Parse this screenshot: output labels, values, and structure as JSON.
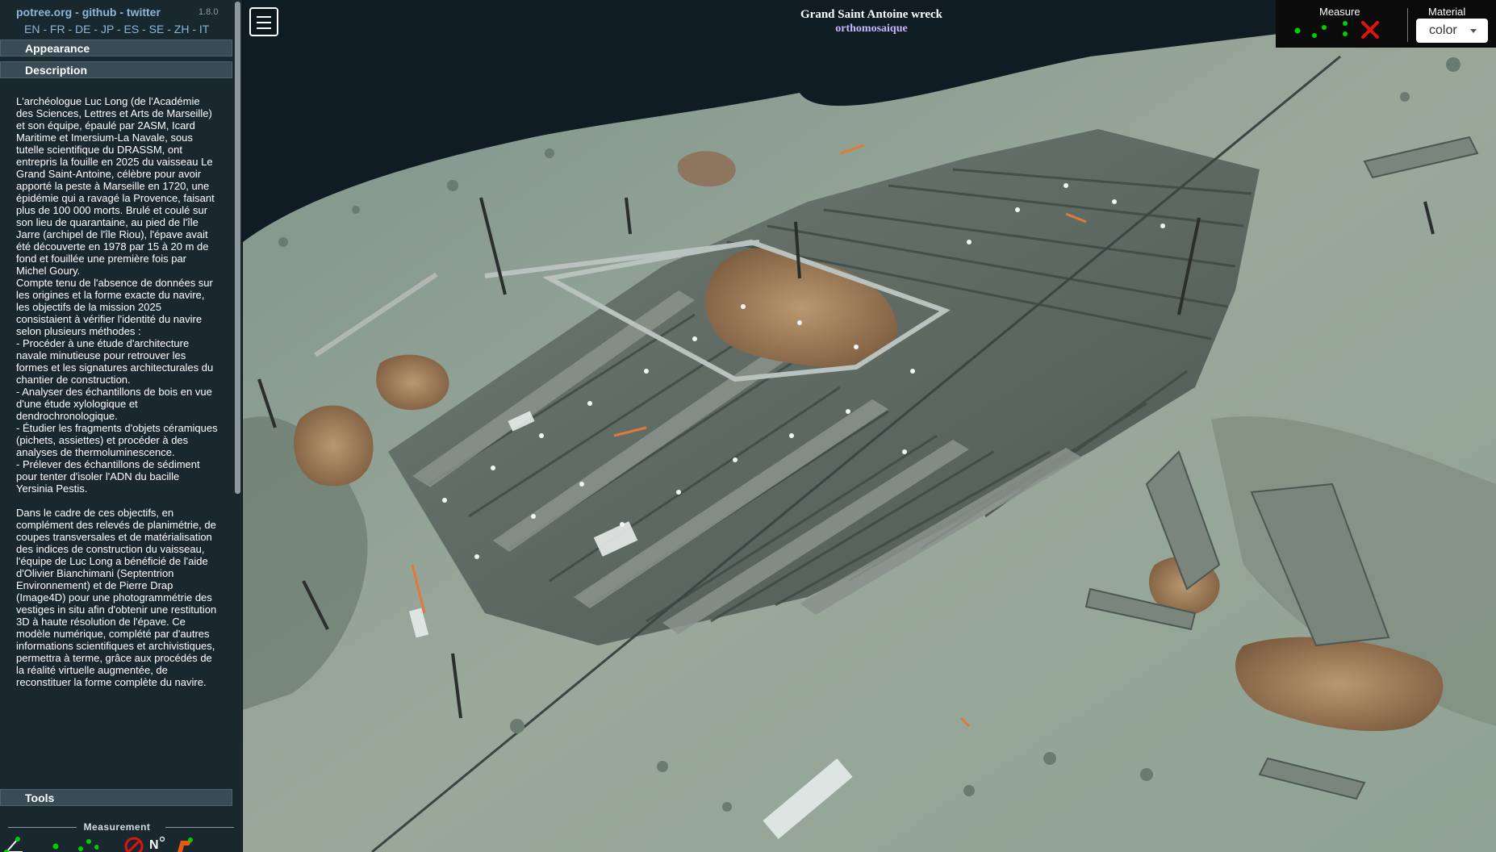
{
  "sidebar": {
    "links": {
      "potree": "potree.org",
      "sep1": " - ",
      "github": "github",
      "sep2": " - ",
      "twitter": "twitter"
    },
    "version": "1.8.0",
    "languages": [
      "EN",
      "FR",
      "DE",
      "JP",
      "ES",
      "SE",
      "ZH",
      "IT"
    ],
    "language_separator": " - ",
    "sections": {
      "appearance": "Appearance",
      "description": "Description",
      "tools": "Tools"
    },
    "description_text": "L'archéologue Luc Long (de l'Académie des Sciences, Lettres et Arts de Marseille) et son équipe, épaulé par 2ASM, Icard Maritime et Imersium-La Navale, sous tutelle scientifique du DRASSM, ont entrepris la fouille en 2025 du vaisseau Le Grand Saint-Antoine, célèbre pour avoir apporté la peste à Marseille en 1720, une épidémie qui a ravagé la Provence, faisant plus de 100 000 morts. Brulé et coulé sur son lieu de quarantaine, au pied de l'île Jarre (archipel de l'île Riou), l'épave avait été découverte en 1978 par 15 à 20 m de fond et fouillée une première fois par Michel Goury.\nCompte tenu de l'absence de données sur les origines et la forme exacte du navire, les objectifs de la mission 2025 consistaient à vérifier l'identité du navire selon plusieurs méthodes :\n- Procéder à une étude d'architecture navale minutieuse pour retrouver les formes et les signatures architecturales du chantier de construction.\n- Analyser des échantillons de bois en vue d'une étude xylologique et dendrochronologique.\n- Étudier les fragments d'objets céramiques (pichets, assiettes) et procéder à des analyses de thermoluminescence.\n- Prélever des échantillons de sédiment pour tenter d'isoler l'ADN du bacille Yersinia Pestis.\n\nDans le cadre de ces objectifs, en complément des relevés de planimétrie, de coupes transversales et de matérialisation des indices de construction du vaisseau, l'équipe de Luc Long a bénéficié de l'aide d'Olivier Bianchimani (Septentrion Environnement) et de Pierre Drap (Image4D) pour une photogrammétrie des vestiges in situ afin d'obtenir une restitution 3D à haute résolution de l'épave. Ce modèle numérique, complété par d'autres informations scientifiques et archivistiques, permettra à terme, grâce aux procédés de la réalité virtuelle augmentée, de reconstituer la forme complète du navire.",
    "measurement_title": "Measurement",
    "measurement_icons": [
      "angle-icon",
      "point-icon",
      "distance-icon",
      "height-icon",
      "remove-measurements-icon",
      "north-arrow-icon",
      "annotation-icon"
    ]
  },
  "viewer": {
    "title": "Grand Saint Antoine wreck",
    "subtitle": "orthomosaique",
    "menu_icon": "hamburger-icon"
  },
  "toolbar": {
    "measure_label": "Measure",
    "material_label": "Material",
    "material_value": "color",
    "tools": [
      "point-measure-icon",
      "distance-measure-icon",
      "area-measure-icon",
      "clear-measurements-icon"
    ],
    "close_color": "#e0140e",
    "point_color": "#00d000"
  }
}
